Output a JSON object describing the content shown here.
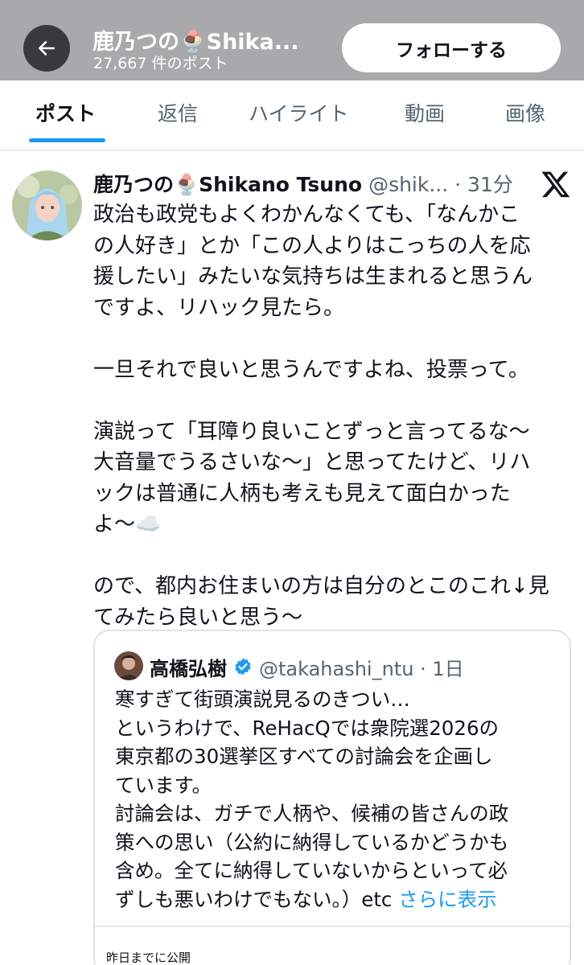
{
  "header": {
    "title": "鹿乃つの🍨Shika...",
    "post_count": "27,667 件のポスト",
    "follow_label": "フォローする"
  },
  "tabs": [
    {
      "label": "ポスト",
      "active": true
    },
    {
      "label": "返信",
      "active": false
    },
    {
      "label": "ハイライト",
      "active": false
    },
    {
      "label": "動画",
      "active": false
    },
    {
      "label": "画像",
      "active": false
    }
  ],
  "post": {
    "author_name": "鹿乃つの🍨Shikano Tsuno",
    "handle_time": "@shik... · 31分",
    "lines": [
      "政治も政党もよくわかんなくても、「なんかこ",
      "の人好き」とか「この人よりはこっちの人を応",
      "援したい」みたいな気持ちは生まれると思うん",
      "ですよ、リハック見たら。",
      "",
      "一旦それで良いと思うんですよね、投票って。",
      "",
      "演説って「耳障り良いことずっと言ってるな～",
      "大音量でうるさいな～」と思ってたけど、リハ",
      "ックは普通に人柄も考えも見えて面白かった",
      "よ～☁️",
      "",
      "ので、都内お住まいの方は自分のとこのこれ↓見",
      "てみたら良いと思う～"
    ]
  },
  "quote": {
    "author_name": "高橋弘樹",
    "handle_time": "@takahashi_ntu · 1日",
    "lines": [
      "寒すぎて街頭演説見るのきつい…",
      "というわけで、ReHacQでは衆院選2026の",
      "東京都の30選挙区すべての討論会を企画し",
      "ています。",
      "討論会は、ガチで人柄や、候補の皆さんの政",
      "策への思い（公約に納得しているかどうかも",
      "含め。全てに納得していないからといって必"
    ],
    "last_line": "ずしも悪いわけでもない。）etc ",
    "show_more": "さらに表示",
    "footer": "昨日までに公開"
  },
  "colors": {
    "accent": "#1d9bf0",
    "header_bg": "#a9a9ab",
    "text": "#0f1419",
    "muted": "#536471"
  }
}
